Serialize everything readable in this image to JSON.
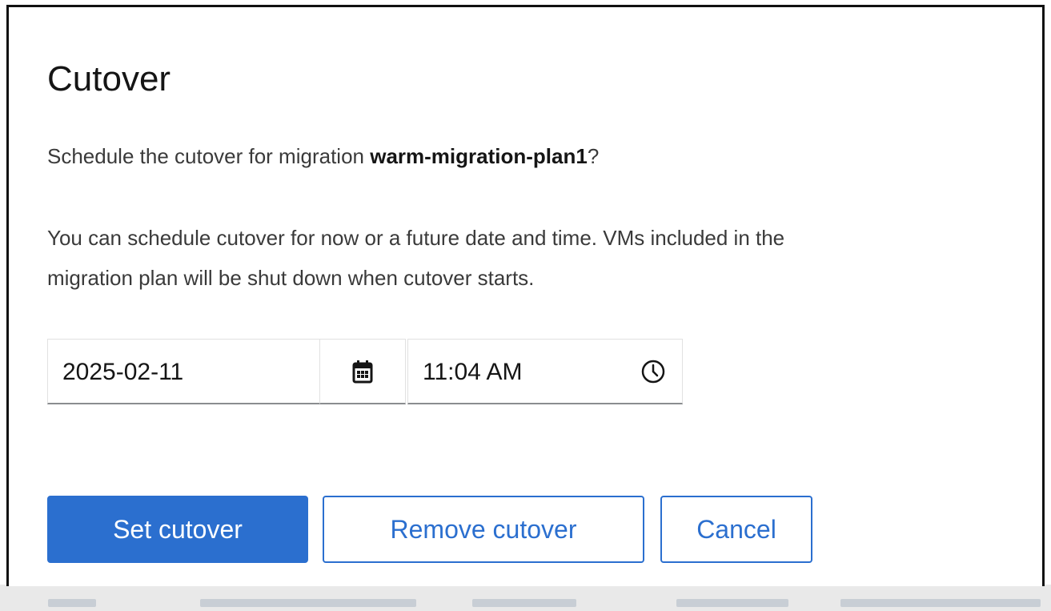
{
  "modal": {
    "title": "Cutover",
    "prompt_prefix": "Schedule the cutover for migration ",
    "plan_name": "warm-migration-plan1",
    "prompt_suffix": "?",
    "description_line1": "You can schedule cutover for now or a future date and time. VMs included in the",
    "description_line2": "migration plan will be shut down when cutover starts."
  },
  "schedule": {
    "date_value": "2025-02-11",
    "time_value": "11:04 AM",
    "calendar_icon": "calendar-icon",
    "clock_icon": "clock-icon"
  },
  "actions": {
    "set_label": "Set cutover",
    "remove_label": "Remove cutover",
    "cancel_label": "Cancel"
  },
  "colors": {
    "primary": "#2b6fcf",
    "text": "#151515",
    "border": "#8a8d90"
  }
}
